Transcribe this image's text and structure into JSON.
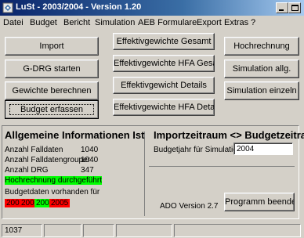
{
  "window": {
    "title": "LuSt - 2003/2004 - Version 1.20"
  },
  "menu": [
    "Datei",
    "Budget",
    "Bericht",
    "Simulation",
    "AEB Formulare",
    "Export",
    "Extras",
    "?"
  ],
  "buttons": {
    "left": [
      "Import",
      "G-DRG starten",
      "Gewichte berechnen",
      "Budget erfassen"
    ],
    "middle": [
      "Effektivgewichte Gesamt",
      "Effektivgewichte HFA Gesamt",
      "Effektivgewicht Details",
      "Effektivgewichte HFA Details"
    ],
    "right": [
      "Hochrechnung",
      "Simulation allg.",
      "Simulation einzeln"
    ],
    "quit": "Programm beenden"
  },
  "info": {
    "title": "Allgemeine Informationen Ist",
    "rows": [
      {
        "label": "Anzahl Falldaten",
        "value": "1040"
      },
      {
        "label": "Anzahl Falldatengrouper",
        "value": "1040"
      },
      {
        "label": "Anzahl DRG",
        "value": "347"
      }
    ],
    "highlight": "Hochrechnung durchgeführt",
    "budget_label": "Budgetdaten vorhanden für",
    "years": [
      {
        "year": "2002",
        "color": "#ff0000"
      },
      {
        "year": "2003",
        "color": "#ff0000"
      },
      {
        "year": "2004",
        "color": "#00ff00"
      },
      {
        "year": "2005",
        "color": "#ff0000"
      }
    ]
  },
  "import": {
    "title": "Importzeitraum <> Budgetzeitraum?",
    "budget_label": "Budgetjahr für Simulation:",
    "budget_value": "2004",
    "ado_version": "ADO Version 2.7"
  },
  "statusbar": {
    "cell1": "1037"
  }
}
